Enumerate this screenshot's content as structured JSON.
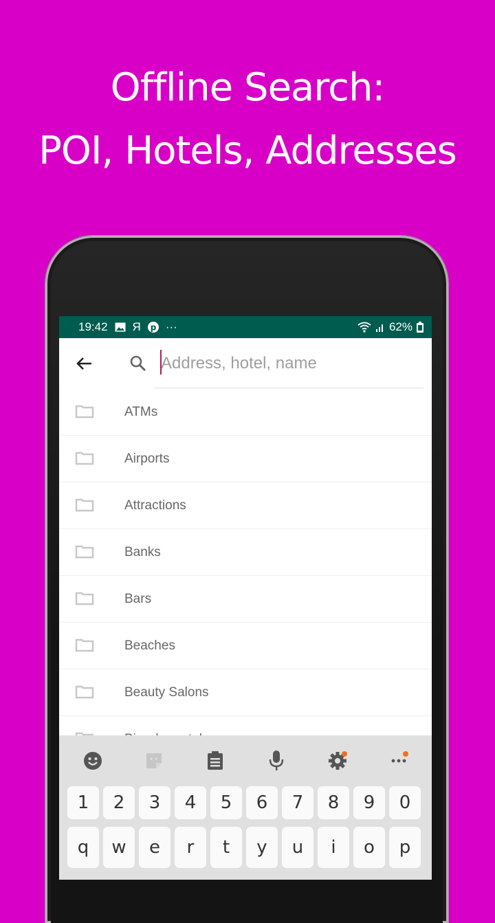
{
  "promo": {
    "headline_line1": "Offline Search:",
    "headline_line2": "POI, Hotels, Addresses",
    "background_color": "#d800c6"
  },
  "status_bar": {
    "time": "19:42",
    "icons_left": [
      "image-icon",
      "yandex-icon",
      "pinterest-icon",
      "more-notifications-icon"
    ],
    "yandex_glyph": "Я",
    "more_glyph": "···",
    "icons_right": [
      "wifi-icon",
      "signal-icon",
      "battery-icon"
    ],
    "battery_percent": "62%",
    "color": "#005c4f"
  },
  "search": {
    "placeholder": "Address, hotel, name",
    "value": "",
    "caret_color": "#b0185a"
  },
  "categories": [
    {
      "label": "ATMs"
    },
    {
      "label": "Airports"
    },
    {
      "label": "Attractions"
    },
    {
      "label": "Banks"
    },
    {
      "label": "Bars"
    },
    {
      "label": "Beaches"
    },
    {
      "label": "Beauty Salons"
    },
    {
      "label": "Bicycle rentals"
    }
  ],
  "keyboard": {
    "toolbar": [
      "emoji-icon",
      "sticker-icon",
      "clipboard-icon",
      "microphone-icon",
      "settings-icon",
      "more-icon"
    ],
    "number_row": [
      "1",
      "2",
      "3",
      "4",
      "5",
      "6",
      "7",
      "8",
      "9",
      "0"
    ],
    "letter_row": [
      "q",
      "w",
      "e",
      "r",
      "t",
      "y",
      "u",
      "i",
      "o",
      "p"
    ],
    "notification_dot_color": "#f07020"
  }
}
